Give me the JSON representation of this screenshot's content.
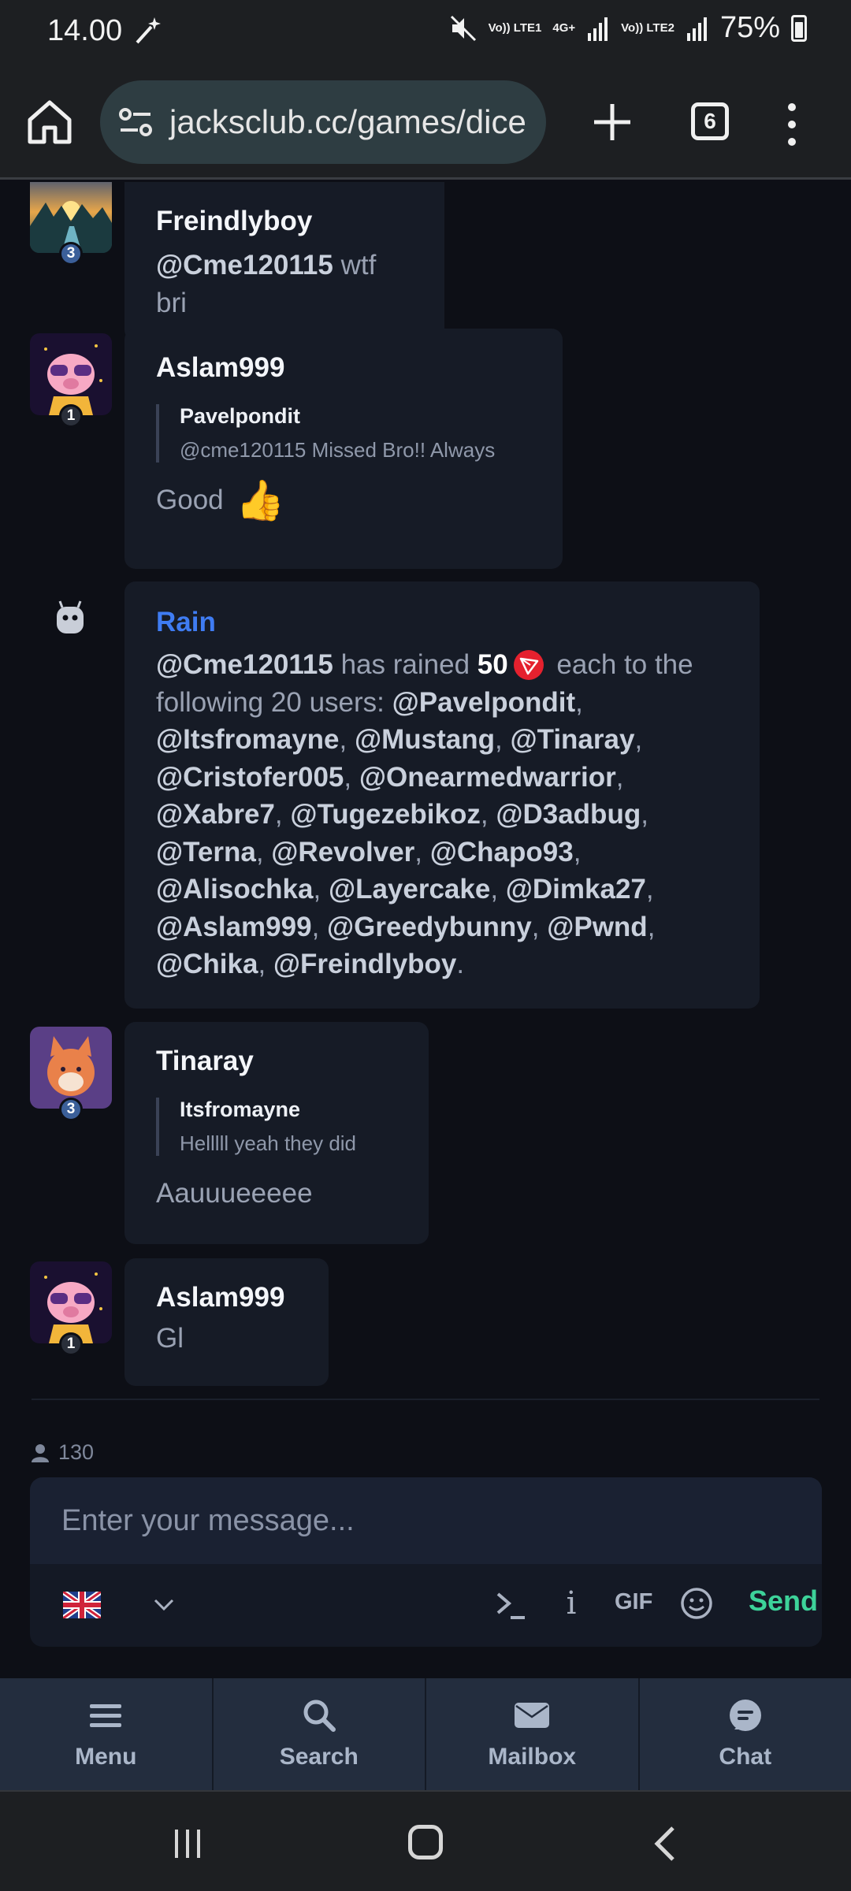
{
  "status_bar": {
    "time": "14.00",
    "sim1": "Vo)) LTE1",
    "network1": "4G+",
    "sim2": "Vo)) LTE2",
    "battery": "75%"
  },
  "browser": {
    "url": "jacksclub.cc/games/dice",
    "tab_count": "6"
  },
  "messages": [
    {
      "user": "Freindlyboy",
      "level": "3",
      "mention": "@Cme120115",
      "text": " wtf bri"
    },
    {
      "user": "Aslam999",
      "level": "1",
      "quote_user": "Pavelpondit",
      "quote_text": "@cme120115 Missed Bro!! Always",
      "text": "Good",
      "emoji": "👍"
    },
    {
      "user": "Tinaray",
      "level": "3",
      "quote_user": "Itsfromayne",
      "quote_text": "Helllll yeah they did",
      "text": "Aauuueeeee"
    },
    {
      "user": "Aslam999",
      "level": "1",
      "text": "Gl"
    }
  ],
  "rain": {
    "title": "Rain",
    "sender": "@Cme120115",
    "pre_amount": " has rained ",
    "amount": "50",
    "post_amount": " each to the following 20 users: ",
    "users": [
      "@Pavelpondit",
      "@Itsfromayne",
      "@Mustang",
      "@Tinaray",
      "@Cristofer005",
      "@Onearmedwarrior",
      "@Xabre7",
      "@Tugezebikoz",
      "@D3adbug",
      "@Terna",
      "@Revolver",
      "@Chapo93",
      "@Alisochka",
      "@Layercake",
      "@Dimka27",
      "@Aslam999",
      "@Greedybunny",
      "@Pwnd",
      "@Chika",
      "@Freindlyboy"
    ]
  },
  "online_count": "130",
  "composer": {
    "placeholder": "Enter your message...",
    "gif_label": "GIF",
    "send_label": "Send"
  },
  "bottom_nav": [
    {
      "label": "Menu",
      "icon": "menu-icon"
    },
    {
      "label": "Search",
      "icon": "search-icon"
    },
    {
      "label": "Mailbox",
      "icon": "mail-icon"
    },
    {
      "label": "Chat",
      "icon": "chat-icon"
    }
  ],
  "colors": {
    "accent_send": "#3dd39a",
    "rain_title": "#3f7cf2",
    "background": "#0d0f16"
  }
}
